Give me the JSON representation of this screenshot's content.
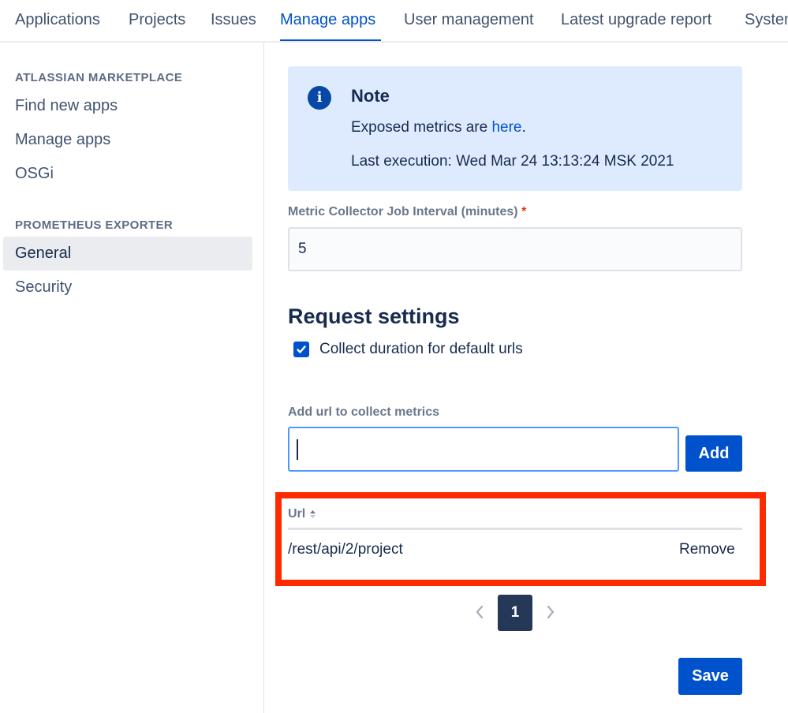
{
  "topnav": {
    "tabs": [
      {
        "label": "Applications"
      },
      {
        "label": "Projects"
      },
      {
        "label": "Issues"
      },
      {
        "label": "Manage apps"
      },
      {
        "label": "User management"
      },
      {
        "label": "Latest upgrade report"
      },
      {
        "label": "System"
      }
    ],
    "active_tab": "Manage apps"
  },
  "sidebar": {
    "sections": [
      {
        "heading": "ATLASSIAN MARKETPLACE",
        "items": [
          {
            "label": "Find new apps"
          },
          {
            "label": "Manage apps"
          },
          {
            "label": "OSGi"
          }
        ]
      },
      {
        "heading": "PROMETHEUS EXPORTER",
        "items": [
          {
            "label": "General"
          },
          {
            "label": "Security"
          }
        ]
      }
    ],
    "selected_item": "General"
  },
  "note": {
    "icon": "info-icon",
    "icon_glyph": "i",
    "title": "Note",
    "metrics_prefix": "Exposed metrics are ",
    "metrics_link": "here",
    "metrics_suffix": ".",
    "last_execution": "Last execution: Wed Mar 24 13:13:24 MSK 2021"
  },
  "job_interval": {
    "label": "Metric Collector Job Interval (minutes)",
    "required_marker": "*",
    "value": "5"
  },
  "request_settings": {
    "title": "Request settings",
    "collect_duration_label": "Collect duration for default urls",
    "collect_duration_checked": true
  },
  "add_url": {
    "label": "Add url to collect metrics",
    "value": "",
    "button_label": "Add"
  },
  "url_table": {
    "column_header": "Url",
    "sort_icon": "sort-icon",
    "rows": [
      {
        "url": "/rest/api/2/project",
        "action": "Remove"
      }
    ]
  },
  "pagination": {
    "current_page": "1",
    "prev_icon": "chevron-left-icon",
    "next_icon": "chevron-right-icon"
  },
  "save_label": "Save",
  "colors": {
    "primary": "#0052cc",
    "note_bg": "#deebff",
    "highlight": "#ff2a00",
    "page_active": "#253858"
  }
}
